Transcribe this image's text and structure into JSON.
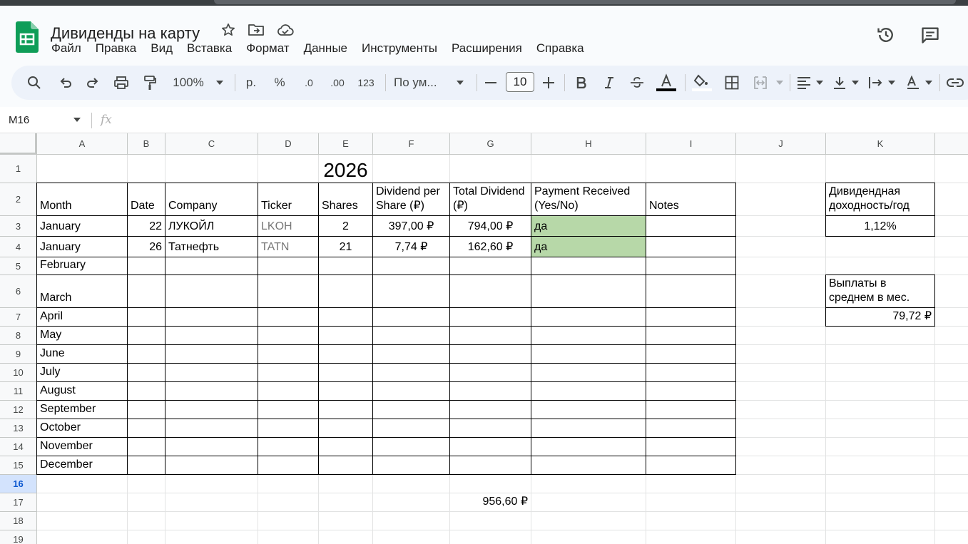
{
  "app": {
    "doc_title": "Дивиденды на карту",
    "menu": [
      "Файл",
      "Правка",
      "Вид",
      "Вставка",
      "Формат",
      "Данные",
      "Инструменты",
      "Расширения",
      "Справка"
    ]
  },
  "toolbar": {
    "zoom": "100%",
    "currency": "р.",
    "percent": "%",
    "dec_decrease": ".0",
    "dec_increase": ".00",
    "format_123": "123",
    "font": "По ум...",
    "font_size": "10"
  },
  "formula_bar": {
    "cell_ref": "M16",
    "fx": "fx"
  },
  "columns": [
    "A",
    "B",
    "C",
    "D",
    "E",
    "F",
    "G",
    "H",
    "I",
    "J",
    "K"
  ],
  "rows": [
    "1",
    "2",
    "3",
    "4",
    "5",
    "6",
    "7",
    "8",
    "9",
    "10",
    "11",
    "12",
    "13",
    "14",
    "15",
    "16",
    "17",
    "18",
    "19"
  ],
  "sheet": {
    "year": "2026",
    "headers": {
      "month": "Month",
      "date": "Date",
      "company": "Company",
      "ticker": "Ticker",
      "shares": "Shares",
      "div_per_share": "Dividend per Share (₽)",
      "total_div": "Total Dividend (₽)",
      "payment": "Payment Received (Yes/No)",
      "notes": "Notes"
    },
    "entries": [
      {
        "month": "January",
        "date": "22",
        "company": "ЛУКОЙЛ",
        "ticker": "LKOH",
        "shares": "2",
        "dps": "397,00 ₽",
        "total": "794,00 ₽",
        "paid": "да"
      },
      {
        "month": "January",
        "date": "26",
        "company": "Татнефть",
        "ticker": "TATN",
        "shares": "21",
        "dps": "7,74 ₽",
        "total": "162,60 ₽",
        "paid": "да"
      }
    ],
    "months": [
      "February",
      "March",
      "April",
      "May",
      "June",
      "July",
      "August",
      "September",
      "October",
      "November",
      "December"
    ],
    "total_sum": "956,60 ₽",
    "yield_label": "Дивидендная доходность/год",
    "yield_value": "1,12%",
    "avg_label": "Выплаты в среднем в мес.",
    "avg_value": "79,72 ₽"
  },
  "colors": {
    "accent": "#0b57d0",
    "paid_fill": "#b7d8a8",
    "sheets_green": "#0f9d58"
  }
}
